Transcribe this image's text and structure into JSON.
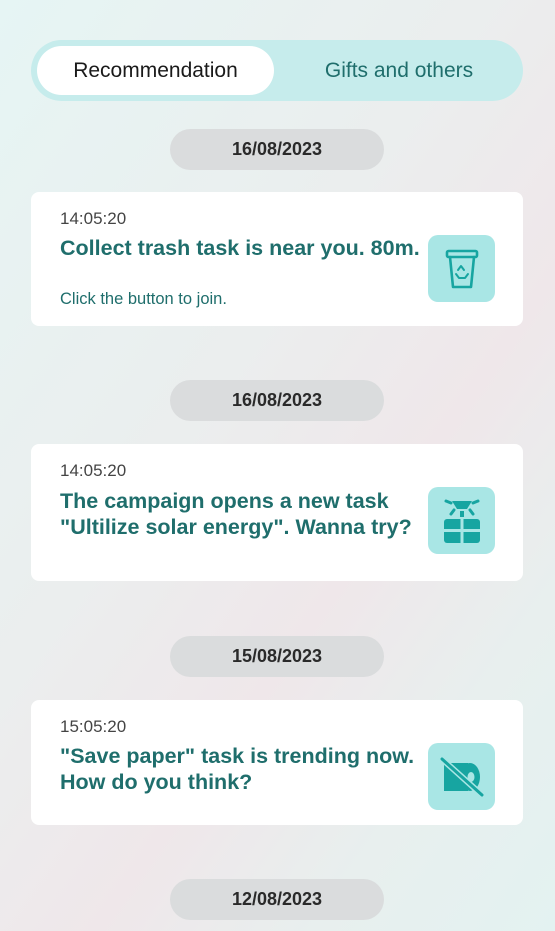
{
  "tabs": [
    {
      "label": "Recommendation",
      "active": true
    },
    {
      "label": "Gifts and others",
      "active": false
    }
  ],
  "notifications": [
    {
      "date": "16/08/2023",
      "time": "14:05:20",
      "message": "Collect trash task is near you. 80m.",
      "sub": "Click the button to join.",
      "icon": "recycle-bin-icon"
    },
    {
      "date": "16/08/2023",
      "time": "14:05:20",
      "message": "The campaign opens a new task \"Ultilize solar energy\". Wanna try?",
      "icon": "solar-panel-icon"
    },
    {
      "date": "15/08/2023",
      "time": "15:05:20",
      "message": "\"Save paper\" task is trending now. How do you think?",
      "icon": "no-paper-icon"
    }
  ],
  "last_date": "12/08/2023",
  "colors": {
    "accent": "#1f6e6c",
    "icon": "#17a5a1",
    "icon_bg": "#a9e6e5",
    "tab_bg": "#c6ecec",
    "date_pill": "#dadcdd"
  }
}
